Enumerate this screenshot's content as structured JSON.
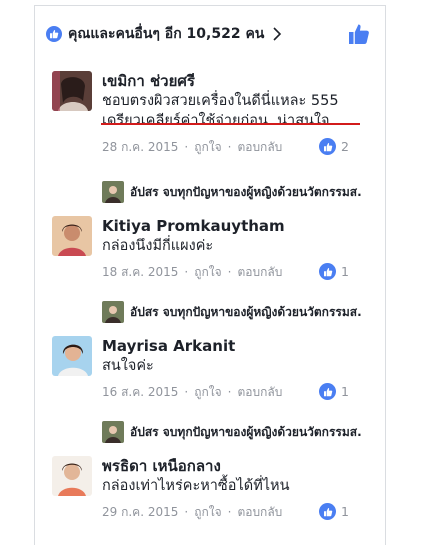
{
  "likes_bar": {
    "summary": "คุณและคนอื่นๆ อีก 10,522 คน"
  },
  "comments": [
    {
      "author": "เขมิกา ช่วยศรี",
      "lines": [
        "ชอบตรงผิวสวยเครื่องในดีนี่แหละ 555",
        "เดรียวเคลียร์ค่าใช้จ่ายก่อน. น่าสนใจ"
      ],
      "date": "28 ก.ค. 2015",
      "like_label": "ถูกใจ",
      "reply_label": "ตอบกลับ",
      "like_count": "2",
      "reply_preview": "อัปสร จบทุกปัญหาของผู้หญิงด้วยนวัตกรรมส."
    },
    {
      "author": "Kitiya Promkauytham",
      "lines": [
        "กล่องนึงมีกี่แผงค่ะ"
      ],
      "date": "18 ส.ค. 2015",
      "like_label": "ถูกใจ",
      "reply_label": "ตอบกลับ",
      "like_count": "1",
      "reply_preview": "อัปสร จบทุกปัญหาของผู้หญิงด้วยนวัตกรรมส."
    },
    {
      "author": "Mayrisa Arkanit",
      "lines": [
        "สนใจค่ะ"
      ],
      "date": "16 ส.ค. 2015",
      "like_label": "ถูกใจ",
      "reply_label": "ตอบกลับ",
      "like_count": "1",
      "reply_preview": "อัปสร จบทุกปัญหาของผู้หญิงด้วยนวัตกรรมส."
    },
    {
      "author": "พรธิดา เหนือกลาง",
      "lines": [
        "กล่องเท่าไหร่คะหาซื้อได้ที่ไหน"
      ],
      "date": "29 ก.ค. 2015",
      "like_label": "ถูกใจ",
      "reply_label": "ตอบกลับ",
      "like_count": "1"
    }
  ],
  "colors": {
    "like_blue": "#4a7ef2",
    "meta_gray": "#90949c",
    "underline_red": "#d21b1b"
  },
  "icons": [
    "like-icon",
    "chevron-right-icon",
    "thumbs-up-icon",
    "avatar"
  ]
}
